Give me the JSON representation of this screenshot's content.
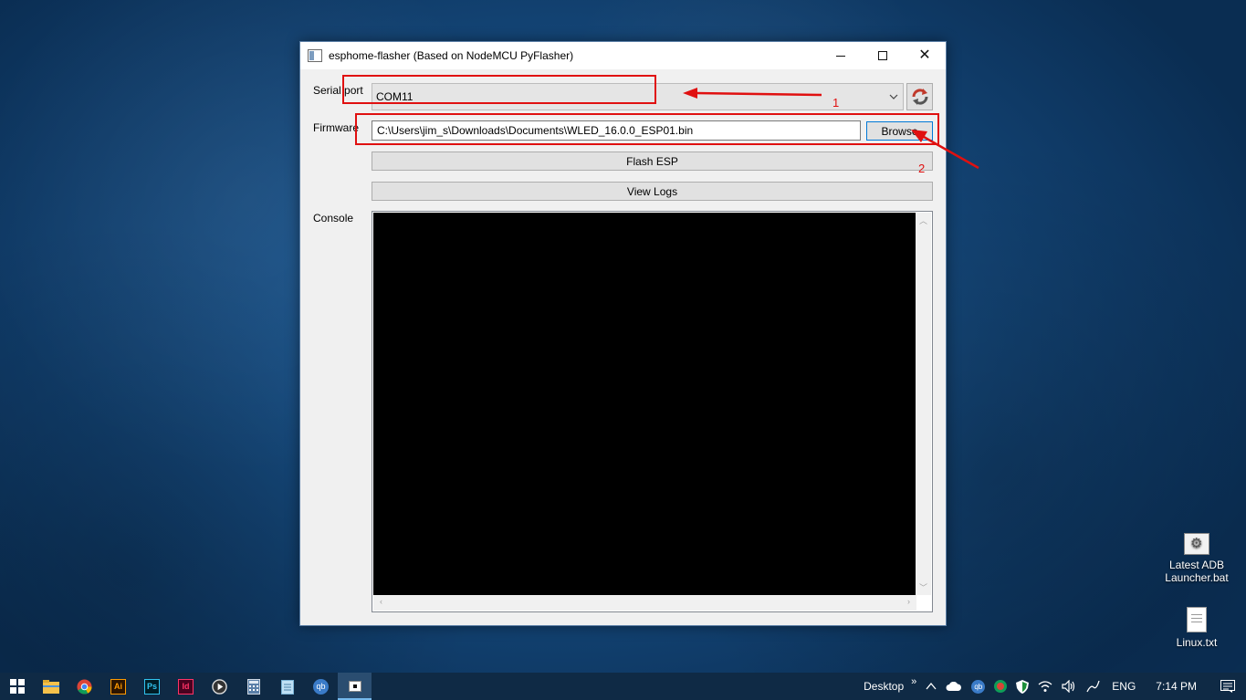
{
  "window": {
    "title": "esphome-flasher (Based on NodeMCU PyFlasher)",
    "minimize": "–",
    "close": "✕"
  },
  "form": {
    "serial_label": "Serial port",
    "serial_value": "COM11",
    "firmware_label": "Firmware",
    "firmware_value": "C:\\Users\\jim_s\\Downloads\\Documents\\WLED_16.0.0_ESP01.bin",
    "browse_label": "Browse",
    "flash_label": "Flash ESP",
    "logs_label": "View Logs",
    "console_label": "Console"
  },
  "annotations": {
    "one": "1",
    "two": "2",
    "color": "#e01010"
  },
  "desktop_icons": [
    {
      "label": "Latest ADB Launcher.bat",
      "icon": "batch-file-icon"
    },
    {
      "label": "Linux.txt",
      "icon": "text-file-icon"
    }
  ],
  "taskbar": {
    "apps": [
      "start",
      "file-explorer",
      "chrome",
      "illustrator",
      "photoshop",
      "indesign",
      "media-player",
      "calculator",
      "notepad",
      "qbittorrent",
      "esphome-flasher"
    ],
    "illustrator_label": "Ai",
    "photoshop_label": "Ps",
    "indesign_label": "Id",
    "qb_label": "qb",
    "desktop_label": "Desktop",
    "lang": "ENG",
    "time": "7:14 PM",
    "accent": "#76b9ed"
  },
  "colors": {
    "desktop": "#174d82",
    "console_bg": "#000000",
    "focus_border": "#0078d7"
  }
}
